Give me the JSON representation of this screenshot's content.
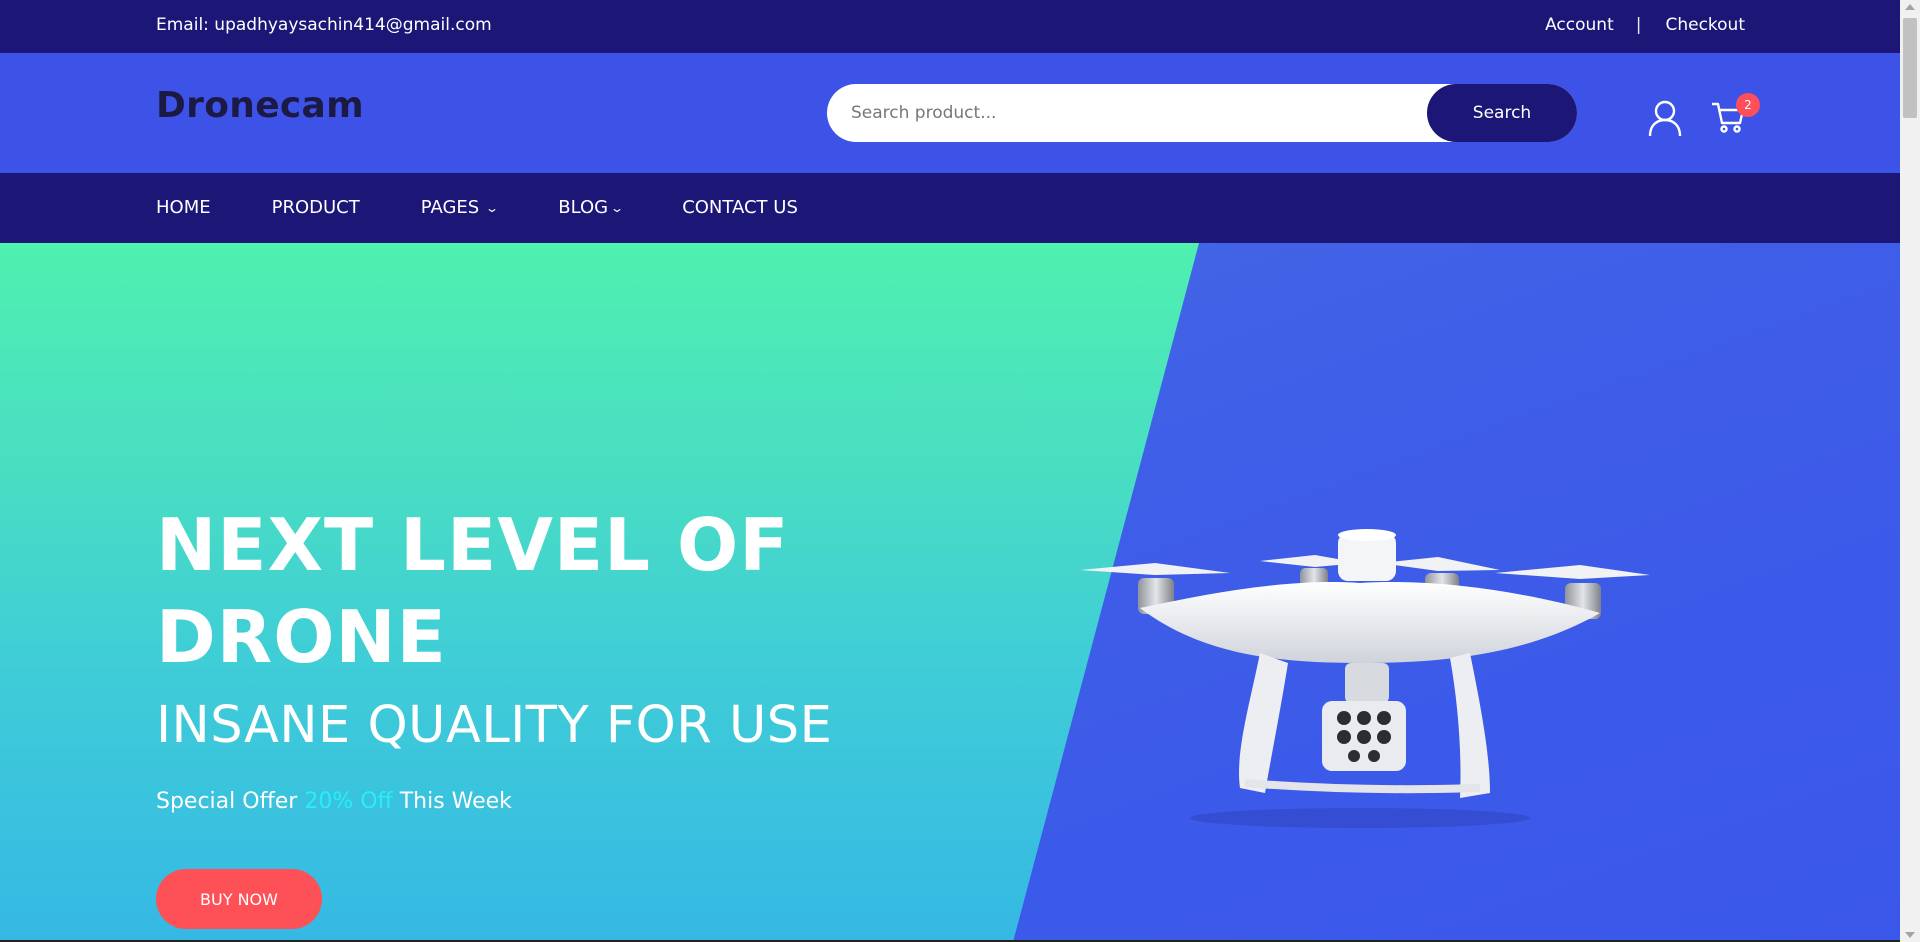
{
  "topbar": {
    "email": "Email: upadhyaysachin414@gmail.com",
    "account_label": "Account",
    "separator": "|",
    "checkout_label": "Checkout"
  },
  "header": {
    "logo": "Dronecam",
    "search_placeholder": "Search product...",
    "search_button": "Search",
    "user_icon": "user-icon",
    "cart_icon": "cart-icon",
    "cart_count": "2"
  },
  "nav": {
    "items": [
      {
        "label": "HOME",
        "has_dropdown": false
      },
      {
        "label": "PRODUCT",
        "has_dropdown": false
      },
      {
        "label": "PAGES",
        "has_dropdown": true
      },
      {
        "label": "BLOG",
        "has_dropdown": true
      },
      {
        "label": "CONTACT US",
        "has_dropdown": false
      }
    ]
  },
  "hero": {
    "headline": "NEXT LEVEL OF DRONE",
    "subheadline": "INSANE QUALITY FOR USE",
    "offer_prefix": "Special Offer",
    "offer_highlight": "20% Off",
    "offer_suffix": "This Week",
    "cta": "BUY NOW"
  },
  "colors": {
    "topbar": "#1c1677",
    "header": "#3d52e7",
    "nav": "#1c1677",
    "hero_left": "#4ff0b0",
    "hero_right": "#3e5de8",
    "accent": "#fd5157",
    "highlight": "#28eefb"
  }
}
